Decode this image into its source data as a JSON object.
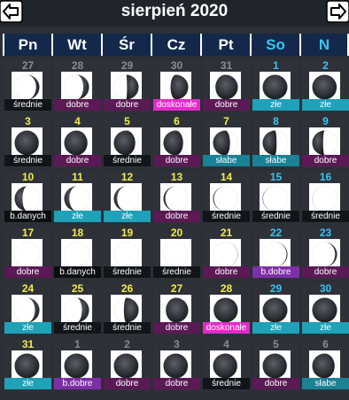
{
  "header": {
    "title": "sierpień 2020"
  },
  "weekdays": [
    {
      "label": "Pn",
      "weekend": false
    },
    {
      "label": "Wt",
      "weekend": false
    },
    {
      "label": "Śr",
      "weekend": false
    },
    {
      "label": "Cz",
      "weekend": false
    },
    {
      "label": "Pt",
      "weekend": false
    },
    {
      "label": "So",
      "weekend": true
    },
    {
      "label": "N",
      "weekend": true
    }
  ],
  "colors": {
    "background": "#2b2f36",
    "header_bg": "#13284a",
    "weekday_text": "#ffffff",
    "weekend_text": "#37c6f5",
    "current_month_number": "#f2ee4a",
    "other_month_number": "#8a8d93"
  },
  "days": [
    {
      "num": "27",
      "month": "prev",
      "phase": 0.88,
      "rating": "średnie",
      "rating_class": "srednie"
    },
    {
      "num": "28",
      "month": "prev",
      "phase": 0.84,
      "rating": "dobre",
      "rating_class": "dobre"
    },
    {
      "num": "29",
      "month": "prev",
      "phase": 0.76,
      "rating": "dobre",
      "rating_class": "dobre"
    },
    {
      "num": "30",
      "month": "prev",
      "phase": 0.68,
      "rating": "doskonałe",
      "rating_class": "doskonale"
    },
    {
      "num": "31",
      "month": "prev",
      "phase": 0.6,
      "rating": "dobre",
      "rating_class": "dobre"
    },
    {
      "num": "1",
      "month": "cur",
      "phase": 0.5,
      "rating": "złe",
      "rating_class": "zle"
    },
    {
      "num": "2",
      "month": "cur",
      "phase": 0.46,
      "rating": "złe",
      "rating_class": "zle"
    },
    {
      "num": "3",
      "month": "cur",
      "phase": 0.45,
      "rating": "średnie",
      "rating_class": "srednie"
    },
    {
      "num": "4",
      "month": "cur",
      "phase": 0.42,
      "rating": "dobre",
      "rating_class": "dobre"
    },
    {
      "num": "5",
      "month": "cur",
      "phase": 0.38,
      "rating": "średnie",
      "rating_class": "srednie"
    },
    {
      "num": "6",
      "month": "cur",
      "phase": 0.35,
      "rating": "dobre",
      "rating_class": "dobre"
    },
    {
      "num": "7",
      "month": "cur",
      "phase": 0.31,
      "rating": "słabe",
      "rating_class": "slabe"
    },
    {
      "num": "8",
      "month": "cur",
      "phase": 0.27,
      "rating": "słabe",
      "rating_class": "slabe"
    },
    {
      "num": "9",
      "month": "cur",
      "phase": 0.23,
      "rating": "dobre",
      "rating_class": "dobre"
    },
    {
      "num": "10",
      "month": "cur",
      "phase": 0.19,
      "rating": "b.danych",
      "rating_class": "bdanych"
    },
    {
      "num": "11",
      "month": "cur",
      "phase": 0.15,
      "rating": "złe",
      "rating_class": "zle"
    },
    {
      "num": "12",
      "month": "cur",
      "phase": 0.12,
      "rating": "złe",
      "rating_class": "zle"
    },
    {
      "num": "13",
      "month": "cur",
      "phase": 0.09,
      "rating": "dobre",
      "rating_class": "dobre"
    },
    {
      "num": "14",
      "month": "cur",
      "phase": 0.06,
      "rating": "średnie",
      "rating_class": "srednie"
    },
    {
      "num": "15",
      "month": "cur",
      "phase": 0.04,
      "rating": "średnie",
      "rating_class": "srednie"
    },
    {
      "num": "16",
      "month": "cur",
      "phase": 0.02,
      "rating": "średnie",
      "rating_class": "srednie"
    },
    {
      "num": "17",
      "month": "cur",
      "phase": 0.0,
      "rating": "dobre",
      "rating_class": "dobre"
    },
    {
      "num": "18",
      "month": "cur",
      "phase": 0.0,
      "rating": "b.danych",
      "rating_class": "bdanych"
    },
    {
      "num": "19",
      "month": "cur",
      "phase": 0.0,
      "rating": "średnie",
      "rating_class": "srednie"
    },
    {
      "num": "20",
      "month": "cur",
      "phase": 0.0,
      "rating": "średnie",
      "rating_class": "srednie"
    },
    {
      "num": "21",
      "month": "cur",
      "phase": 0.97,
      "rating": "dobre",
      "rating_class": "dobre"
    },
    {
      "num": "22",
      "month": "cur",
      "phase": 0.94,
      "rating": "b.dobre",
      "rating_class": "bdobre"
    },
    {
      "num": "23",
      "month": "cur",
      "phase": 0.91,
      "rating": "dobre",
      "rating_class": "dobre"
    },
    {
      "num": "24",
      "month": "cur",
      "phase": 0.86,
      "rating": "złe",
      "rating_class": "zle"
    },
    {
      "num": "25",
      "month": "cur",
      "phase": 0.82,
      "rating": "średnie",
      "rating_class": "srednie"
    },
    {
      "num": "26",
      "month": "cur",
      "phase": 0.72,
      "rating": "średnie",
      "rating_class": "srednie"
    },
    {
      "num": "27",
      "month": "cur",
      "phase": 0.6,
      "rating": "dobre",
      "rating_class": "dobre"
    },
    {
      "num": "28",
      "month": "cur",
      "phase": 0.55,
      "rating": "doskonałe",
      "rating_class": "doskonale"
    },
    {
      "num": "29",
      "month": "cur",
      "phase": 0.5,
      "rating": "złe",
      "rating_class": "zle"
    },
    {
      "num": "30",
      "month": "cur",
      "phase": 0.5,
      "rating": "złe",
      "rating_class": "zle"
    },
    {
      "num": "31",
      "month": "cur",
      "phase": 0.48,
      "rating": "złe",
      "rating_class": "zle"
    },
    {
      "num": "1",
      "month": "next",
      "phase": 0.48,
      "rating": "b.dobre",
      "rating_class": "bdobre"
    },
    {
      "num": "2",
      "month": "next",
      "phase": 0.47,
      "rating": "dobre",
      "rating_class": "dobre"
    },
    {
      "num": "3",
      "month": "next",
      "phase": 0.46,
      "rating": "dobre",
      "rating_class": "dobre"
    },
    {
      "num": "4",
      "month": "next",
      "phase": 0.45,
      "rating": "średnie",
      "rating_class": "srednie"
    },
    {
      "num": "5",
      "month": "next",
      "phase": 0.45,
      "rating": "dobre",
      "rating_class": "dobre"
    },
    {
      "num": "6",
      "month": "next",
      "phase": 0.4,
      "rating": "słabe",
      "rating_class": "slabe"
    }
  ]
}
